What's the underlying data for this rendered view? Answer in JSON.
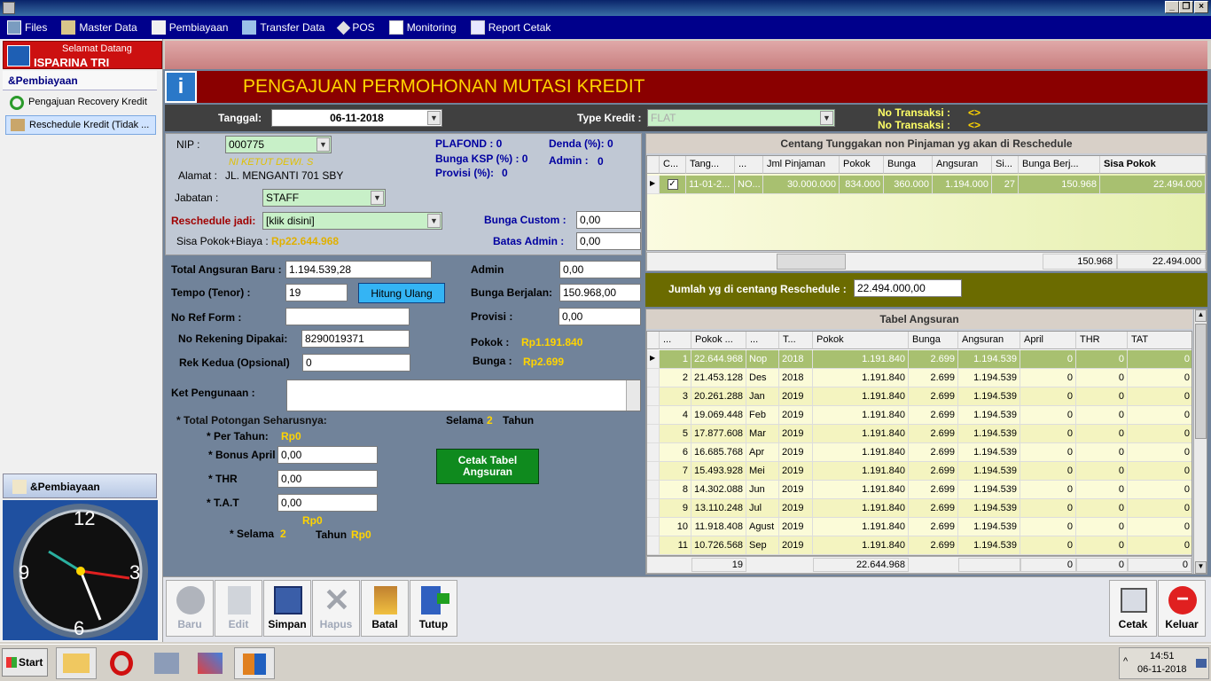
{
  "menu": [
    "Files",
    "Master Data",
    "Pembiayaan",
    "Transfer Data",
    "POS",
    "Monitoring",
    "Report Cetak"
  ],
  "welcome": {
    "line1": "Selamat Datang",
    "line2": "ISPARINA TRI AGUSTIN"
  },
  "sidebar": {
    "header": "&Pembiayaan",
    "items": [
      "Pengajuan Recovery Kredit",
      "Reschedule Kredit (Tidak ..."
    ],
    "bottom": "&Pembiayaan"
  },
  "form": {
    "title": "PENGAJUAN PERMOHONAN MUTASI KREDIT",
    "tanggal_label": "Tanggal:",
    "tanggal": "06-11-2018",
    "type_kredit_label": "Type Kredit :",
    "type_kredit": "FLAT",
    "no_trans_label": "No Transaksi :",
    "no_trans_val": "<>",
    "nip_label": "NIP :",
    "nip": "000775",
    "nama": "NI KETUT DEWI. S",
    "alamat_label": "Alamat :",
    "alamat": "JL. MENGANTI 701 SBY",
    "jabatan_label": "Jabatan :",
    "jabatan": "STAFF",
    "reschedule_label": "Reschedule jadi:",
    "reschedule": "[klik disini]",
    "sisa_label": "Sisa Pokok+Biaya :",
    "sisa": "Rp22.644.968",
    "plafond": "PLAFOND : 0",
    "denda": "Denda (%): 0",
    "bunga_ksp": "Bunga KSP (%) : 0",
    "admin_top": "Admin :",
    "admin_top_val": "0",
    "provisi_top": "Provisi (%):",
    "provisi_top_val": "0",
    "bunga_custom_label": "Bunga Custom :",
    "bunga_custom": "0,00",
    "batas_admin_label": "Batas Admin :",
    "batas_admin": "0,00",
    "total_angs_label": "Total Angsuran Baru :",
    "total_angs": "1.194.539,28",
    "tempo_label": "Tempo (Tenor) :",
    "tempo": "19",
    "hitung": "Hitung Ulang",
    "ref_label": "No Ref Form :",
    "ref": "",
    "rek_label": "No Rekening Dipakai:",
    "rek": "8290019371",
    "rek2_label": "Rek Kedua (Opsional)",
    "rek2": "0",
    "admin_label": "Admin",
    "admin": "0,00",
    "bunga_berj_label": "Bunga Berjalan:",
    "bunga_berj": "150.968,00",
    "provisi_label": "Provisi :",
    "provisi": "0,00",
    "pokok_label": "Pokok :",
    "pokok": "Rp1.191.840",
    "bunga_label": "Bunga :",
    "bunga": "Rp2.699",
    "ket_label": "Ket Pengunaan :",
    "ket": "",
    "total_pot": "* Total Potongan Seharusnya:",
    "per_tahun_label": "* Per Tahun:",
    "per_tahun": "Rp0",
    "bonus_label": "* Bonus April",
    "bonus": "0,00",
    "thr_label": "* THR",
    "thr": "0,00",
    "tat_label": "* T.A.T",
    "tat": "0,00",
    "tat_rp": "Rp0",
    "selama_label": "* Selama",
    "selama_val": "2",
    "tahun_label": "Tahun",
    "tahun_rp": "Rp0",
    "selama2_label": "Selama",
    "selama2_val": "2",
    "tahun2": "Tahun",
    "cetak_tabel": "Cetak Tabel Angsuran"
  },
  "tunggakan": {
    "title": "Centang Tunggakan non Pinjaman yg akan di Reschedule",
    "headers": [
      "C...",
      "Tang...",
      "...",
      "Jml Pinjaman",
      "Pokok",
      "Bunga",
      "Angsuran",
      "Si...",
      "Bunga Berj...",
      "Sisa Pokok"
    ],
    "row": [
      "",
      "11-01-2...",
      "NO...",
      "30.000.000",
      "834.000",
      "360.000",
      "1.194.000",
      "27",
      "150.968",
      "22.494.000"
    ],
    "foot1": "150.968",
    "foot2": "22.494.000"
  },
  "jumlah_label": "Jumlah yg di centang Reschedule :",
  "jumlah": "22.494.000,00",
  "angsuran": {
    "title": "Tabel Angsuran",
    "headers": [
      "...",
      "Pokok ...",
      "...",
      "T...",
      "Pokok",
      "Bunga",
      "Angsuran",
      "April",
      "THR",
      "TAT"
    ],
    "rows": [
      [
        "1",
        "22.644.968",
        "Nop",
        "2018",
        "1.191.840",
        "2.699",
        "1.194.539",
        "0",
        "0",
        "0"
      ],
      [
        "2",
        "21.453.128",
        "Des",
        "2018",
        "1.191.840",
        "2.699",
        "1.194.539",
        "0",
        "0",
        "0"
      ],
      [
        "3",
        "20.261.288",
        "Jan",
        "2019",
        "1.191.840",
        "2.699",
        "1.194.539",
        "0",
        "0",
        "0"
      ],
      [
        "4",
        "19.069.448",
        "Feb",
        "2019",
        "1.191.840",
        "2.699",
        "1.194.539",
        "0",
        "0",
        "0"
      ],
      [
        "5",
        "17.877.608",
        "Mar",
        "2019",
        "1.191.840",
        "2.699",
        "1.194.539",
        "0",
        "0",
        "0"
      ],
      [
        "6",
        "16.685.768",
        "Apr",
        "2019",
        "1.191.840",
        "2.699",
        "1.194.539",
        "0",
        "0",
        "0"
      ],
      [
        "7",
        "15.493.928",
        "Mei",
        "2019",
        "1.191.840",
        "2.699",
        "1.194.539",
        "0",
        "0",
        "0"
      ],
      [
        "8",
        "14.302.088",
        "Jun",
        "2019",
        "1.191.840",
        "2.699",
        "1.194.539",
        "0",
        "0",
        "0"
      ],
      [
        "9",
        "13.110.248",
        "Jul",
        "2019",
        "1.191.840",
        "2.699",
        "1.194.539",
        "0",
        "0",
        "0"
      ],
      [
        "10",
        "11.918.408",
        "Agust",
        "2019",
        "1.191.840",
        "2.699",
        "1.194.539",
        "0",
        "0",
        "0"
      ],
      [
        "11",
        "10.726.568",
        "Sep",
        "2019",
        "1.191.840",
        "2.699",
        "1.194.539",
        "0",
        "0",
        "0"
      ]
    ],
    "foot": {
      "count": "19",
      "pokok": "22.644.968",
      "april": "0",
      "thr": "0",
      "tat": "0"
    }
  },
  "toolbar": [
    "Baru",
    "Edit",
    "Simpan",
    "Hapus",
    "Batal",
    "Tutup"
  ],
  "cetak": "Cetak",
  "keluar": "Keluar",
  "taskbar": {
    "start": "Start",
    "time": "14:51",
    "date": "06-11-2018"
  }
}
